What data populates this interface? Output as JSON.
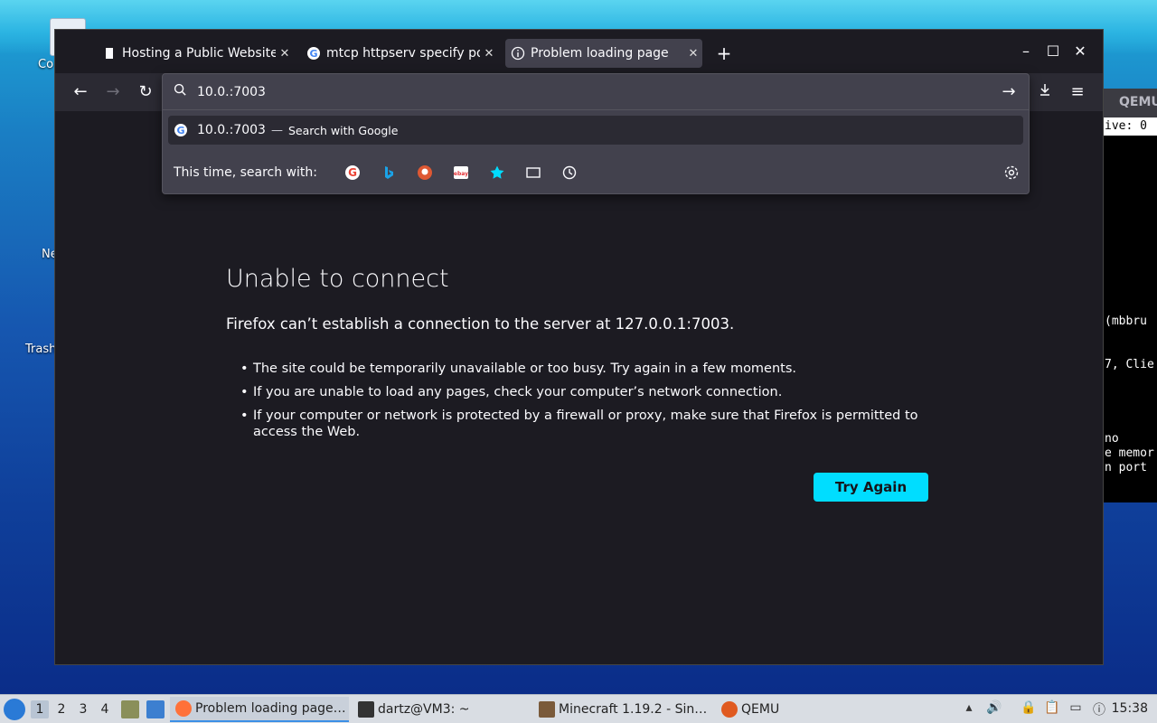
{
  "desktop": {
    "icons": [
      {
        "label": "Co"
      },
      {
        "label": "Ne"
      },
      {
        "label": "Trash"
      }
    ]
  },
  "qemu": {
    "title": "QEMU",
    "status_fragment": "ive: 0",
    "lines": [
      "(mbbru",
      "7, Clie",
      "no",
      "e memor",
      "n port"
    ]
  },
  "browser": {
    "tabs": [
      {
        "title": "Hosting a Public Website",
        "active": false
      },
      {
        "title": "mtcp httpserv specify po",
        "active": false
      },
      {
        "title": "Problem loading page",
        "active": true
      }
    ],
    "url_value": "10.0.:7003",
    "suggestion": {
      "query": "10.0.:7003",
      "separator": "—",
      "action": "Search with Google"
    },
    "search_with_label": "This time, search with:",
    "engines": [
      "google-icon",
      "bing-icon",
      "duckduckgo-icon",
      "ebay-icon",
      "bookmarks-icon",
      "tabs-icon",
      "history-icon"
    ]
  },
  "error_page": {
    "title": "Unable to connect",
    "lead": "Firefox can’t establish a connection to the server at 127.0.0.1:7003.",
    "bullets": [
      "The site could be temporarily unavailable or too busy. Try again in a few moments.",
      "If you are unable to load any pages, check your computer’s network connection.",
      "If your computer or network is protected by a firewall or proxy, make sure that Firefox is permitted to access the Web."
    ],
    "button": "Try Again"
  },
  "taskbar": {
    "workspaces": [
      "1",
      "2",
      "3",
      "4"
    ],
    "tasks": [
      {
        "label": "Problem loading page…",
        "active": true
      },
      {
        "label": "dartz@VM3: ~",
        "active": false
      },
      {
        "label": "Minecraft 1.19.2 - Sin…",
        "active": false
      },
      {
        "label": "QEMU",
        "active": false
      }
    ],
    "clock": "15:38"
  },
  "colors": {
    "accent": "#00ddff",
    "page_bg": "#1c1b22",
    "toolbar_bg": "#2b2a33",
    "urlbar_bg": "#42414d"
  }
}
